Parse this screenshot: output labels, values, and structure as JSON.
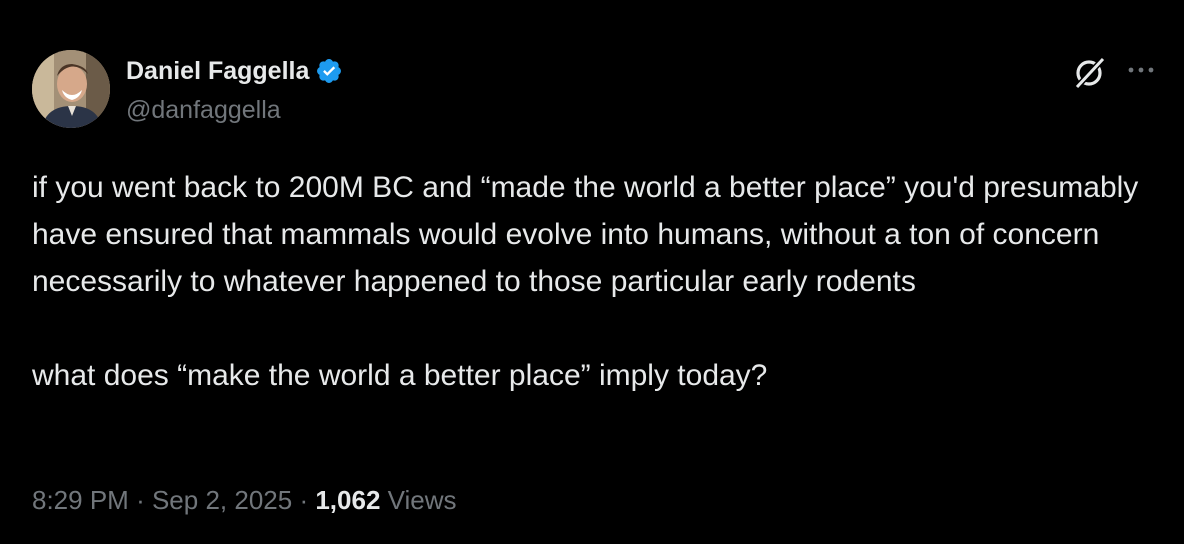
{
  "author": {
    "display_name": "Daniel Faggella",
    "handle": "@danfaggella",
    "verified": true
  },
  "tweet": {
    "text": "if you went back to 200M BC and “made the world a better place” you'd presumably have ensured that mammals would evolve into humans, without a ton of concern necessarily to whatever happened to those particular early rodents\n\nwhat does “make the world a better place” imply today?"
  },
  "meta": {
    "time": "8:29 PM",
    "separator": "·",
    "date": "Sep 2, 2025",
    "views_count": "1,062",
    "views_label": "Views"
  },
  "icons": {
    "verified": "verified-badge-icon",
    "grok": "grok-icon",
    "more": "more-options-icon"
  },
  "colors": {
    "background": "#000000",
    "primary_text": "#e7e9ea",
    "secondary_text": "#71767b",
    "verified_blue": "#1d9bf0"
  }
}
